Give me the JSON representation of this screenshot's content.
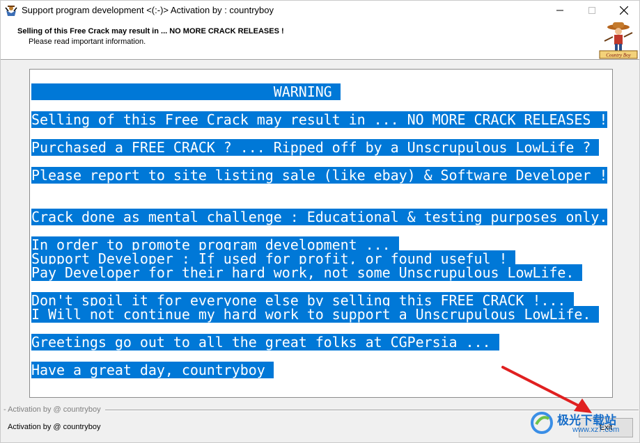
{
  "window": {
    "title": "Support program development <(:-)> Activation by : countryboy"
  },
  "header": {
    "title": "Selling of this Free Crack may result in ... NO MORE CRACK RELEASES !",
    "subtitle": "Please read important information.",
    "logo_text": "Country Boy"
  },
  "message": {
    "lines": [
      "",
      "                             WARNING ",
      "",
      "Selling of this Free Crack may result in ... NO MORE CRACK RELEASES !",
      "",
      "Purchased a FREE CRACK ? ... Ripped off by a Unscrupulous LowLife ? ",
      "",
      "Please report to site listing sale (like ebay) & Software Developer !",
      "",
      "",
      "Crack done as mental challenge : Educational & testing purposes only.",
      "",
      "In order to promote program development ... ",
      "Support Developer : If used for profit, or found useful ! ",
      "Pay Developer for their hard work, not some Unscrupulous LowLife. ",
      "",
      "Don't spoil it for everyone else by selling this FREE CRACK !... ",
      "I Will not continue my hard work to support a Unscrupulous LowLife. ",
      "",
      "Greetings go out to all the great folks at CGPersia ... ",
      "",
      "Have a great day, countryboy "
    ]
  },
  "divider": {
    "label": "- Activation by @ countryboy"
  },
  "footer": {
    "text": "Activation by @ countryboy",
    "exit_label": "Exit"
  },
  "watermark": {
    "text": "极光下载站",
    "url": "www.xz7.com"
  },
  "colors": {
    "selection": "#0078d7",
    "arrow": "#e02020",
    "watermark": "#1a6fc9"
  }
}
